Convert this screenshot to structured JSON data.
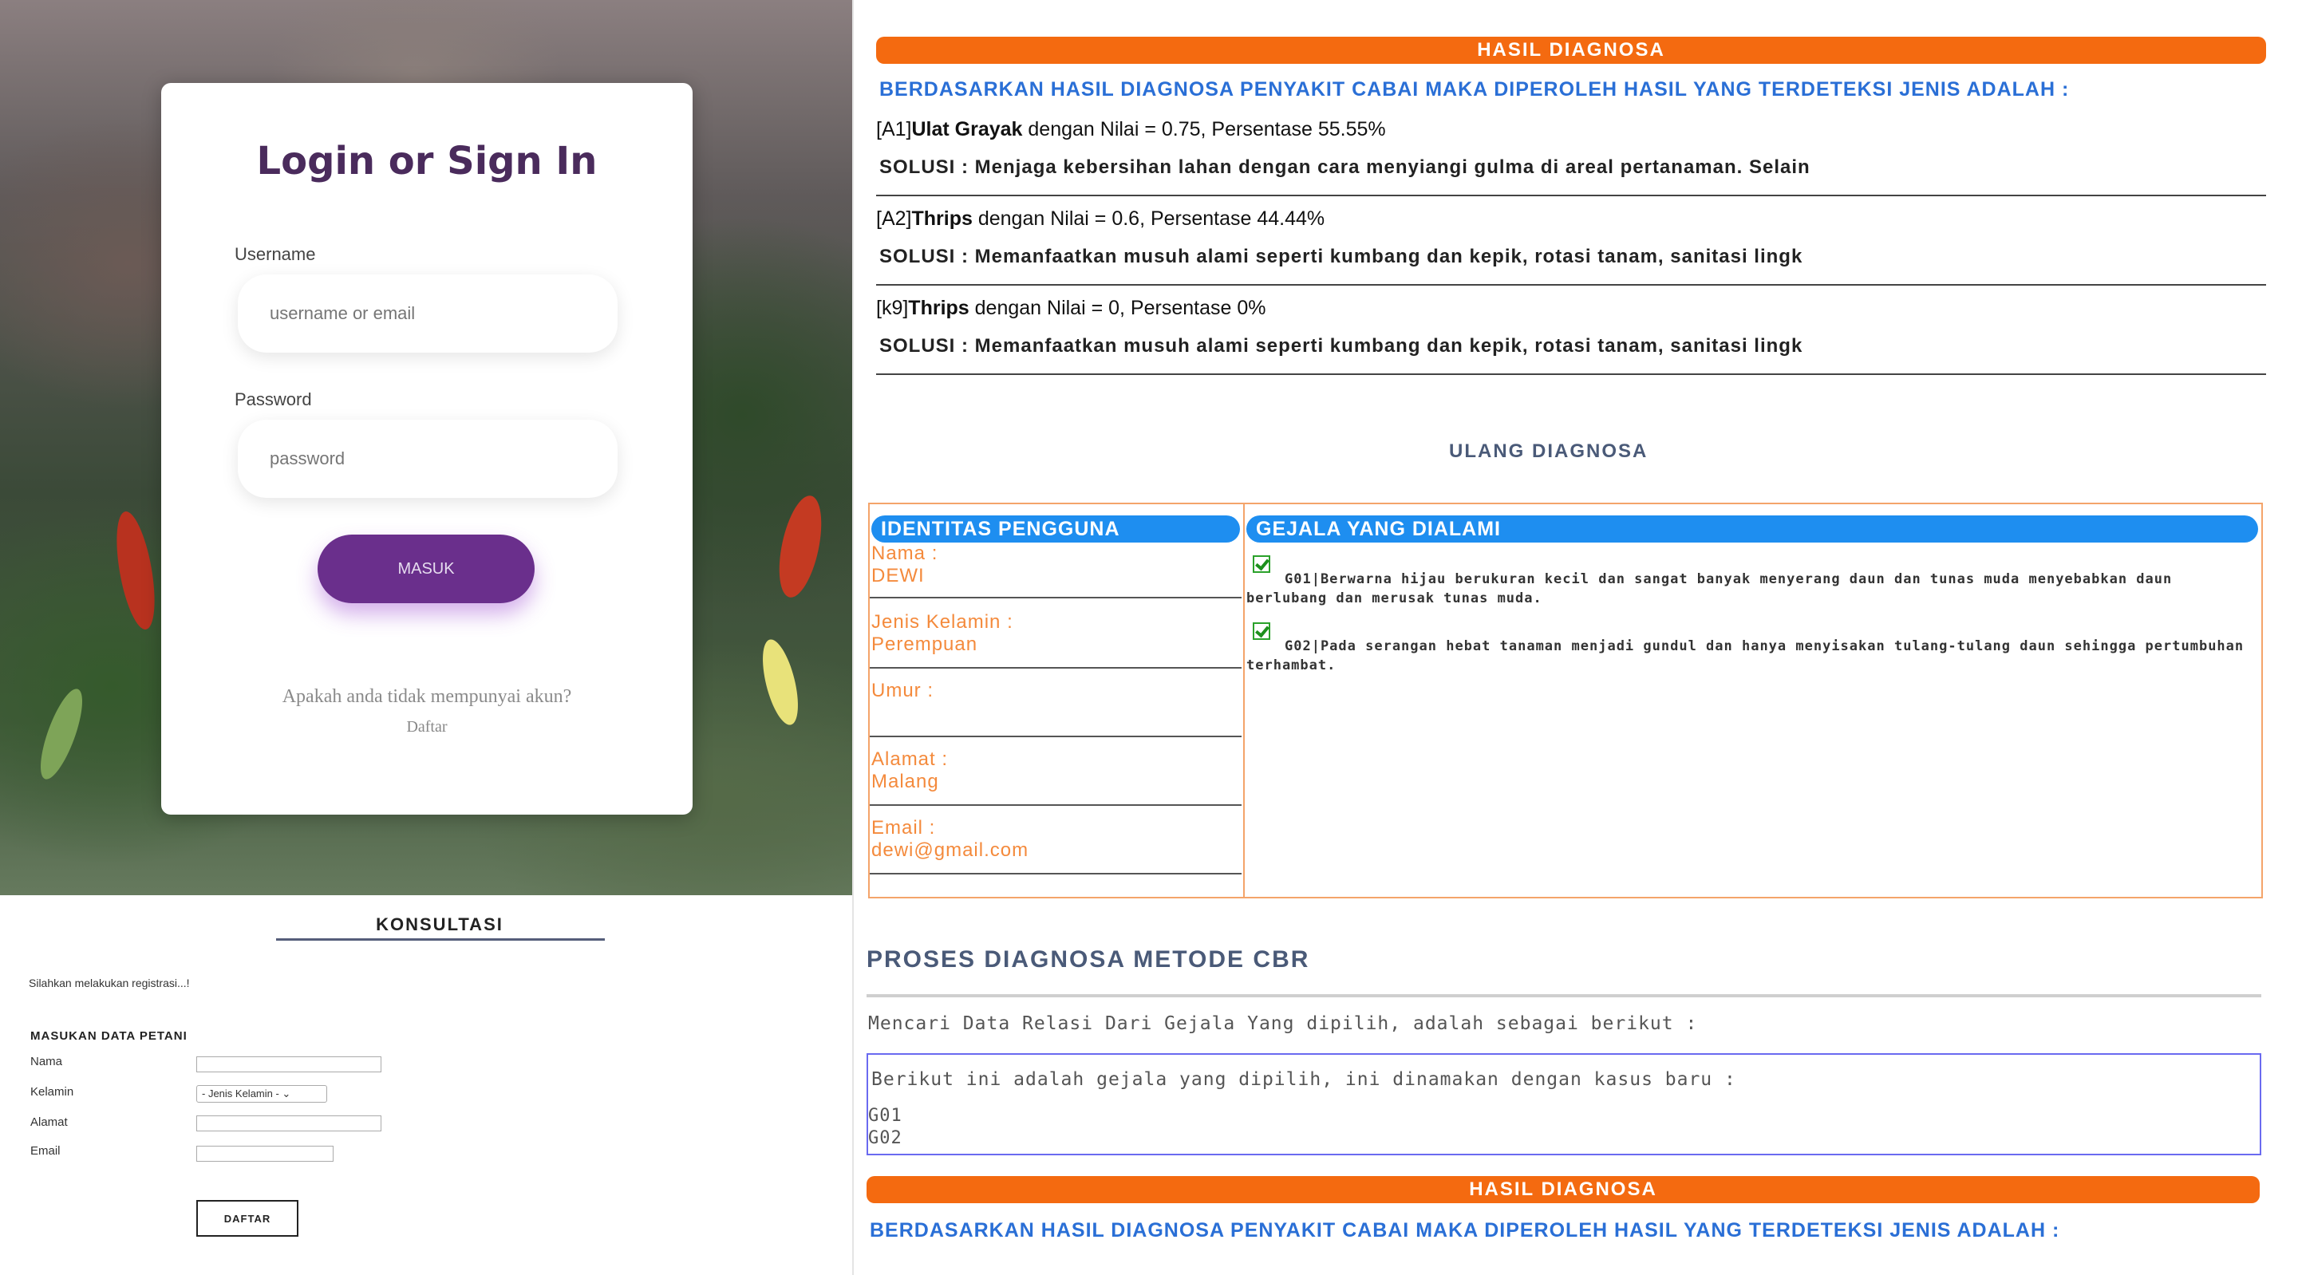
{
  "login": {
    "title": "Login or Sign In",
    "username_label": "Username",
    "username_placeholder": "username or email",
    "password_label": "Password",
    "password_placeholder": "password",
    "submit_label": "MASUK",
    "signup_question": "Apakah anda tidak mempunyai akun?",
    "signup_link": "Daftar"
  },
  "konsultasi": {
    "title": "KONSULTASI",
    "info": "Silahkan melakukan registrasi...!",
    "section_title": "MASUKAN DATA PETANI",
    "fields": {
      "nama": "Nama",
      "kelamin": "Kelamin",
      "alamat": "Alamat",
      "email": "Email"
    },
    "kelamin_selected": "- Jenis Kelamin - ⌄",
    "submit_label": "DAFTAR"
  },
  "hasil_top": {
    "bar_title": "HASIL DIAGNOSA",
    "heading": "BERDASARKAN HASIL DIAGNOSA PENYAKIT CABAI MAKA DIPEROLEH HASIL YANG TERDETEKSI JENIS ADALAH :",
    "results": [
      {
        "code": "[A1]",
        "name": "Ulat Grayak",
        "detail": " dengan Nilai = 0.75, Persentase 55.55%",
        "solution": "SOLUSI : Menjaga kebersihan lahan dengan cara menyiangi gulma di areal pertanaman. Selain"
      },
      {
        "code": "[A2]",
        "name": "Thrips",
        "detail": " dengan Nilai = 0.6, Persentase 44.44%",
        "solution": "SOLUSI : Memanfaatkan musuh alami seperti kumbang dan kepik, rotasi tanam, sanitasi lingk"
      },
      {
        "code": "[k9]",
        "name": "Thrips",
        "detail": " dengan Nilai = 0, Persentase 0%",
        "solution": "SOLUSI : Memanfaatkan musuh alami seperti kumbang dan kepik, rotasi tanam, sanitasi lingk"
      }
    ],
    "ulang": "ULANG DIAGNOSA"
  },
  "identitas": {
    "header": "IDENTITAS PENGGUNA",
    "rows": [
      {
        "label": "Nama :",
        "value": "DEWI"
      },
      {
        "label": "Jenis Kelamin :",
        "value": "Perempuan"
      },
      {
        "label": "Umur :",
        "value": ""
      },
      {
        "label": "Alamat :",
        "value": "Malang"
      },
      {
        "label": "Email :",
        "value": "dewi@gmail.com"
      }
    ]
  },
  "gejala": {
    "header": "GEJALA YANG DIALAMI",
    "items": [
      "G01|Berwarna hijau berukuran kecil dan sangat banyak menyerang daun dan tunas muda menyebabkan daun berlubang dan merusak tunas muda.",
      "G02|Pada serangan hebat tanaman menjadi gundul dan hanya menyisakan tulang-tulang daun sehingga pertumbuhan terhambat."
    ]
  },
  "proses": {
    "title": "PROSES DIAGNOSA METODE CBR",
    "line1": "Mencari Data Relasi Dari Gejala Yang dipilih, adalah sebagai berikut :",
    "box_text": "Berikut ini adalah gejala yang dipilih, ini dinamakan dengan kasus baru :",
    "codes": [
      "G01",
      "G02"
    ]
  },
  "hasil_bottom": {
    "bar_title": "HASIL DIAGNOSA",
    "heading": "BERDASARKAN HASIL DIAGNOSA PENYAKIT CABAI MAKA DIPEROLEH HASIL YANG TERDETEKSI JENIS ADALAH :"
  },
  "colors": {
    "accent_orange": "#f46a10",
    "accent_blue": "#2a6fd6",
    "login_button": "#6a2f8c",
    "identity_text": "#f48a3c"
  },
  "icons": [
    "check-icon"
  ]
}
